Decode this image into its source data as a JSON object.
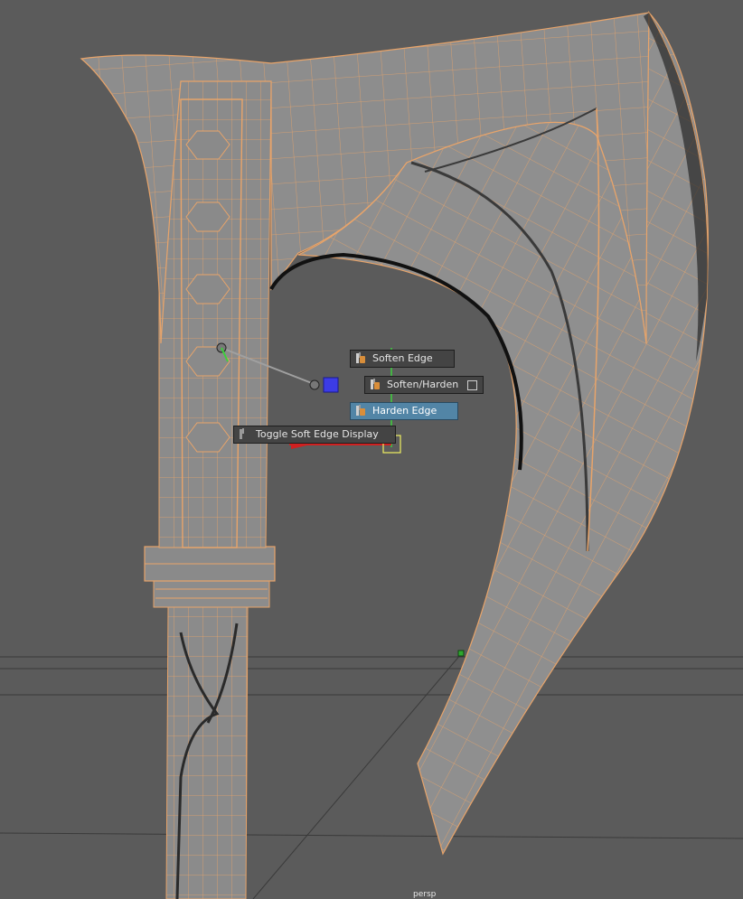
{
  "viewport": {
    "camera": "persp",
    "background_color": "#5b5b5b",
    "mesh_color": "#8a8a8a",
    "wireframe_color": "#f0a060"
  },
  "marking_menu": {
    "items": [
      {
        "label": "Soften Edge",
        "icon": "soften-edge-icon",
        "active": false,
        "has_option_box": false
      },
      {
        "label": "Soften/Harden",
        "icon": "soften-harden-icon",
        "active": false,
        "has_option_box": true
      },
      {
        "label": "Harden Edge",
        "icon": "harden-edge-icon",
        "active": true,
        "has_option_box": false
      },
      {
        "label": "Toggle Soft Edge Display",
        "icon": "toggle-soft-edge-icon",
        "active": false,
        "has_option_box": false
      }
    ],
    "highlight_color": "#5285a6"
  }
}
